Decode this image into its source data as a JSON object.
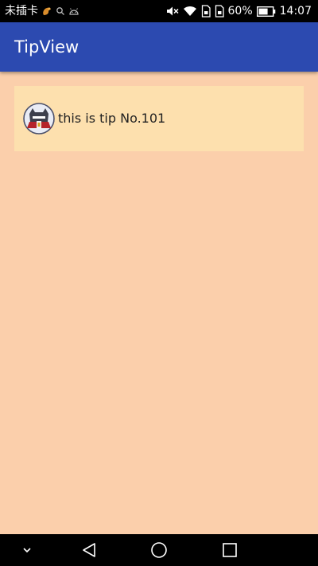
{
  "status_bar": {
    "carrier": "未插卡",
    "battery_percent": "60%",
    "time": "14:07",
    "icons": [
      "notification-icon",
      "search-icon",
      "android-icon",
      "mute-icon",
      "wifi-icon",
      "sim-icon",
      "sim-icon",
      "battery-icon"
    ]
  },
  "app_bar": {
    "title": "TipView",
    "color": "#2c4ab0"
  },
  "tip": {
    "text": "this is tip No.101",
    "avatar": "avatar-icon",
    "background": "#fde0ae"
  },
  "nav_bar": {
    "icons": [
      "chevron-down-icon",
      "back-icon",
      "home-icon",
      "recents-icon"
    ]
  }
}
